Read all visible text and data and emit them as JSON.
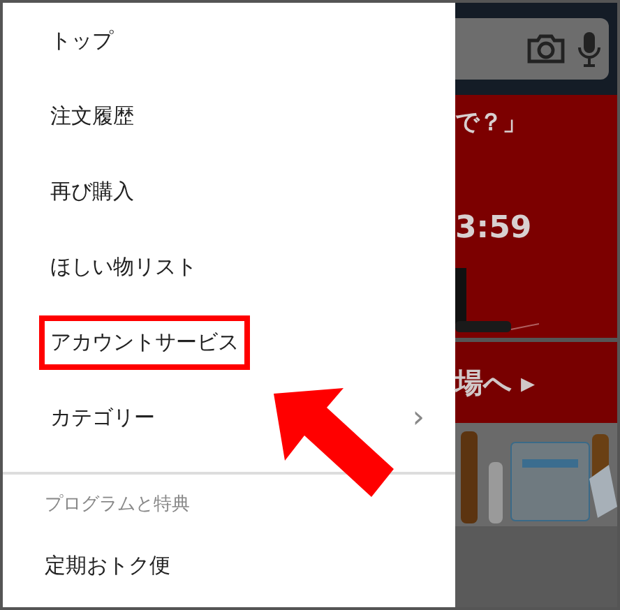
{
  "menu": {
    "items": [
      {
        "label": "トップ",
        "highlighted": false,
        "has_submenu": false
      },
      {
        "label": "注文履歴",
        "highlighted": false,
        "has_submenu": false
      },
      {
        "label": "再び購入",
        "highlighted": false,
        "has_submenu": false
      },
      {
        "label": "ほしい物リスト",
        "highlighted": false,
        "has_submenu": false
      },
      {
        "label": "アカウントサービス",
        "highlighted": true,
        "has_submenu": false
      },
      {
        "label": "カテゴリー",
        "highlighted": false,
        "has_submenu": true
      }
    ],
    "section": {
      "title": "プログラムと特典",
      "items": [
        {
          "label": "定期おトク便"
        }
      ]
    },
    "submenu_glyph": "›"
  },
  "background_page": {
    "banner_lines": [
      "で？」",
      "3:59"
    ],
    "link": "場へ",
    "link_glyph": "▸"
  }
}
